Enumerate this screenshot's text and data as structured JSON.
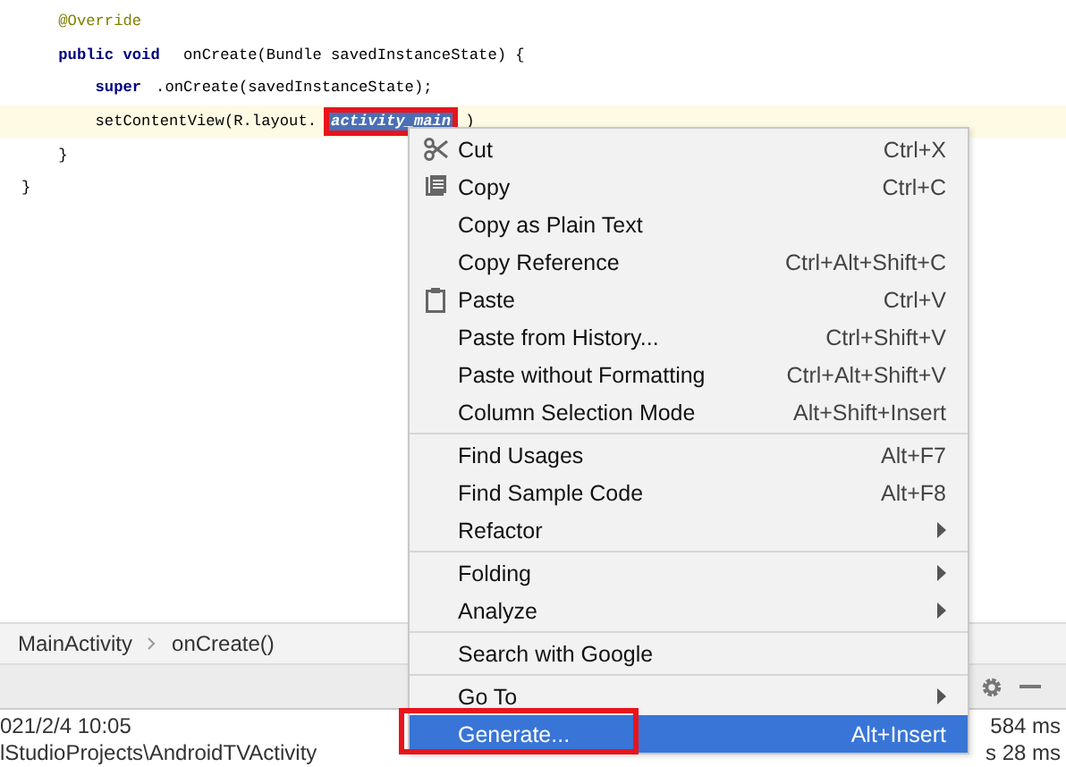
{
  "code": {
    "lines": [
      {
        "current": false,
        "segments": [
          {
            "text": "    @Override",
            "kind": "annotation",
            "marked": false
          }
        ]
      },
      {
        "current": false,
        "segments": [
          {
            "text": "    public void",
            "kind": "keyword",
            "marked": false
          },
          {
            "text": " onCreate(Bundle savedInstanceState) {",
            "kind": "plain",
            "marked": false
          }
        ]
      },
      {
        "current": false,
        "segments": [
          {
            "text": "        super",
            "kind": "keyword",
            "marked": false
          },
          {
            "text": ".onCreate(savedInstanceState);",
            "kind": "plain",
            "marked": false
          }
        ]
      },
      {
        "current": true,
        "segments": [
          {
            "text": "        setContentView(R.layout.",
            "kind": "plain",
            "marked": false
          },
          {
            "text": "activity_main",
            "kind": "selected",
            "marked": true
          },
          {
            "text": ")",
            "kind": "plain",
            "marked": false
          }
        ]
      },
      {
        "current": false,
        "segments": [
          {
            "text": "    }",
            "kind": "plain",
            "marked": false
          }
        ]
      },
      {
        "current": false,
        "segments": [
          {
            "text": "}",
            "kind": "plain",
            "marked": false
          }
        ]
      }
    ]
  },
  "breadcrumbs": [
    "MainActivity",
    "onCreate()"
  ],
  "log": {
    "rows": [
      {
        "text": "021/2/4 10:05",
        "time": "584 ms"
      },
      {
        "text": "lStudioProjects\\AndroidTVActivity",
        "time": "s 28 ms"
      }
    ]
  },
  "context_menu": {
    "items": [
      {
        "kind": "item",
        "label": "Cut",
        "shortcut": "Ctrl+X",
        "submenu": false,
        "selected": false,
        "marked": false
      },
      {
        "kind": "item",
        "label": "Copy",
        "shortcut": "Ctrl+C",
        "submenu": false,
        "selected": false,
        "marked": false
      },
      {
        "kind": "item",
        "label": "Copy as Plain Text",
        "submenu": false,
        "selected": false,
        "marked": false
      },
      {
        "kind": "item",
        "label": "Copy Reference",
        "shortcut": "Ctrl+Alt+Shift+C",
        "submenu": false,
        "selected": false,
        "marked": false
      },
      {
        "kind": "item",
        "label": "Paste",
        "shortcut": "Ctrl+V",
        "submenu": false,
        "selected": false,
        "marked": false
      },
      {
        "kind": "item",
        "label": "Paste from History...",
        "shortcut": "Ctrl+Shift+V",
        "submenu": false,
        "selected": false,
        "marked": false
      },
      {
        "kind": "item",
        "label": "Paste without Formatting",
        "shortcut": "Ctrl+Alt+Shift+V",
        "submenu": false,
        "selected": false,
        "marked": false
      },
      {
        "kind": "item",
        "label": "Column Selection Mode",
        "shortcut": "Alt+Shift+Insert",
        "submenu": false,
        "selected": false,
        "marked": false
      },
      {
        "kind": "separator"
      },
      {
        "kind": "item",
        "label": "Find Usages",
        "shortcut": "Alt+F7",
        "submenu": false,
        "selected": false,
        "marked": false
      },
      {
        "kind": "item",
        "label": "Find Sample Code",
        "shortcut": "Alt+F8",
        "submenu": false,
        "selected": false,
        "marked": false
      },
      {
        "kind": "item",
        "label": "Refactor",
        "submenu": true,
        "selected": false,
        "marked": false
      },
      {
        "kind": "separator"
      },
      {
        "kind": "item",
        "label": "Folding",
        "submenu": true,
        "selected": false,
        "marked": false
      },
      {
        "kind": "item",
        "label": "Analyze",
        "submenu": true,
        "selected": false,
        "marked": false
      },
      {
        "kind": "separator"
      },
      {
        "kind": "item",
        "label": "Search with Google",
        "submenu": false,
        "selected": false,
        "marked": false
      },
      {
        "kind": "separator"
      },
      {
        "kind": "item",
        "label": "Go To",
        "submenu": true,
        "selected": false,
        "marked": false
      },
      {
        "kind": "item",
        "label": "Generate...",
        "shortcut": "Alt+Insert",
        "submenu": false,
        "selected": true,
        "marked": true
      }
    ]
  }
}
